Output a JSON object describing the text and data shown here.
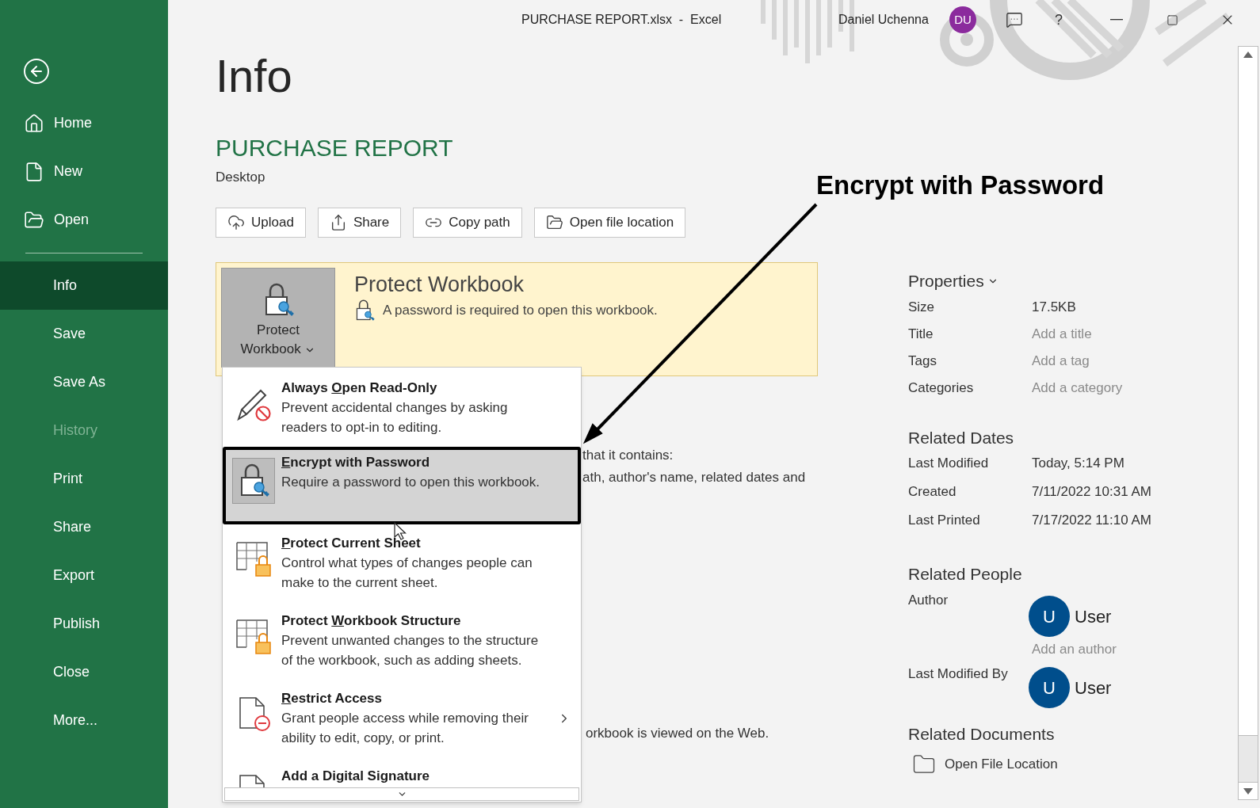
{
  "window": {
    "title": "PURCHASE REPORT.xlsx  -  Excel",
    "user_name": "Daniel Uchenna",
    "user_initials": "DU",
    "help": "?"
  },
  "sidebar": {
    "nav_top": [
      {
        "label": "Home",
        "kind": "home"
      },
      {
        "label": "New",
        "kind": "new"
      },
      {
        "label": "Open",
        "kind": "open"
      }
    ],
    "nav_main": [
      {
        "label": "Info",
        "selected": true,
        "disabled": false
      },
      {
        "label": "Save",
        "selected": false,
        "disabled": false
      },
      {
        "label": "Save As",
        "selected": false,
        "disabled": false
      },
      {
        "label": "History",
        "selected": false,
        "disabled": true
      },
      {
        "label": "Print",
        "selected": false,
        "disabled": false
      },
      {
        "label": "Share",
        "selected": false,
        "disabled": false
      },
      {
        "label": "Export",
        "selected": false,
        "disabled": false
      },
      {
        "label": "Publish",
        "selected": false,
        "disabled": false
      },
      {
        "label": "Close",
        "selected": false,
        "disabled": false
      },
      {
        "label": "More...",
        "selected": false,
        "disabled": false
      }
    ]
  },
  "page": {
    "heading": "Info",
    "file_name": "PURCHASE REPORT",
    "location": "Desktop",
    "actions": [
      {
        "label": "Upload",
        "kind": "upload"
      },
      {
        "label": "Share",
        "kind": "share"
      },
      {
        "label": "Copy path",
        "kind": "link"
      },
      {
        "label": "Open file location",
        "kind": "folder"
      }
    ]
  },
  "protect_panel": {
    "button_label": "Protect Workbook",
    "title": "Protect Workbook",
    "status": "A password is required to open this workbook."
  },
  "partly_hidden_lines": [
    "that it contains:",
    "ath, author's name, related dates and",
    "orkbook is viewed on the Web."
  ],
  "protect_menu": {
    "items": [
      {
        "title_before": "Always ",
        "access_key": "O",
        "title_after": "pen Read-Only",
        "description": "Prevent accidental changes by asking readers to opt-in to editing.",
        "kind": "pencil",
        "selected": false,
        "submenu": false
      },
      {
        "access_key": "E",
        "title_after": "ncrypt with Password",
        "description": "Require a password to open this workbook.",
        "kind": "lock",
        "selected": true,
        "submenu": false
      },
      {
        "access_key": "P",
        "title_after": "rotect Current Sheet",
        "description": "Control what types of changes people can make to the current sheet.",
        "kind": "sheet",
        "selected": false,
        "submenu": false
      },
      {
        "title_before": "Protect ",
        "access_key": "W",
        "title_after": "orkbook Structure",
        "description": "Prevent unwanted changes to the structure of the workbook, such as adding sheets.",
        "kind": "sheet",
        "selected": false,
        "submenu": false
      },
      {
        "access_key": "R",
        "title_after": "estrict Access",
        "description": "Grant people access while removing their ability to edit, copy, or print.",
        "kind": "document",
        "selected": false,
        "submenu": true
      },
      {
        "title_before": "Add a Digital Signature",
        "kind": "document",
        "selected": false
      }
    ]
  },
  "annotation": {
    "label": "Encrypt with Password"
  },
  "properties": {
    "heading": "Properties",
    "rows": [
      {
        "label": "Size",
        "value": "17.5KB",
        "kind": "value"
      },
      {
        "label": "Title",
        "value": "Add a title",
        "kind": "prompt"
      },
      {
        "label": "Tags",
        "value": "Add a tag",
        "kind": "prompt"
      },
      {
        "label": "Categories",
        "value": "Add a category",
        "kind": "prompt"
      }
    ]
  },
  "related_dates": {
    "heading": "Related Dates",
    "rows": [
      {
        "label": "Last Modified",
        "value": "Today, 5:14 PM"
      },
      {
        "label": "Created",
        "value": "7/11/2022 10:31 AM"
      },
      {
        "label": "Last Printed",
        "value": "7/17/2022 11:10 AM"
      }
    ]
  },
  "related_people": {
    "heading": "Related People",
    "author": {
      "label": "Author",
      "initial": "U",
      "name": "User"
    },
    "add_author": "Add an author",
    "last_modified_by": {
      "label": "Last Modified By",
      "initial": "U",
      "name": "User"
    }
  },
  "related_documents": {
    "heading": "Related Documents",
    "items": [
      {
        "label": "Open File Location"
      }
    ]
  }
}
